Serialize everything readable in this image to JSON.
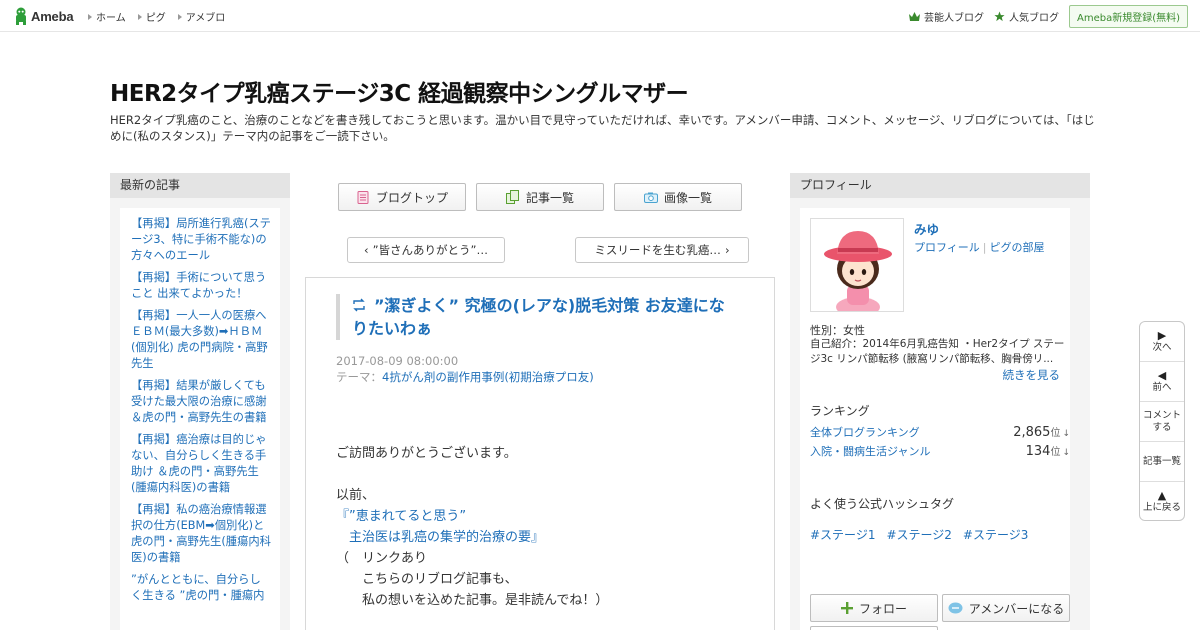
{
  "header": {
    "logo_text": "Ameba",
    "nav": [
      "ホーム",
      "ピグ",
      "アメブロ"
    ],
    "right_links": [
      {
        "label": "芸能人ブログ",
        "icon": "crown-icon"
      },
      {
        "label": "人気ブログ",
        "icon": "star-icon"
      }
    ],
    "register_label": "Ameba新規登録(無料)"
  },
  "blog": {
    "title": "HER2タイプ乳癌ステージ3C 経過観察中シングルマザー",
    "description": "HER2タイプ乳癌のこと、治療のことなどを書き残しておこうと思います。温かい目で見守っていただければ、幸いです。アメンバー申請、コメント、メッセージ、リブログについては、「はじめに(私のスタンス)」テーマ内の記事をご一読下さい。"
  },
  "left_sidebar": {
    "heading": "最新の記事",
    "recent": [
      "【再掲】局所進行乳癌(ステージ3、特に手術不能な)の方々へのエール",
      "【再掲】手術について思うこと 出来てよかった！",
      "【再掲】一人一人の医療へ ＥＢＭ(最大多数)➡ＨＢＭ(個別化) 虎の門病院・高野先生",
      "【再掲】結果が厳しくても受けた最大限の治療に感謝 ＆虎の門・高野先生の書籍",
      "【再掲】癌治療は目的じゃない、自分らしく生きる手助け ＆虎の門・高野先生(腫瘍内科医)の書籍",
      "【再掲】私の癌治療情報選択の仕方(EBM➡個別化)と虎の門・高野先生(腫瘍内科医)の書籍",
      "”がんとともに、自分らしく生きる ”虎の門・腫瘍内"
    ]
  },
  "center": {
    "buttons": [
      {
        "label": "ブログトップ",
        "icon": "document-icon"
      },
      {
        "label": "記事一覧",
        "icon": "copy-icon"
      },
      {
        "label": "画像一覧",
        "icon": "camera-icon"
      }
    ],
    "prev_label": "”皆さんありがとう”…",
    "next_label": "ミスリードを生む乳癌…",
    "article": {
      "title": "”潔ぎよく” 究極の(レアな)脱毛対策 お友達になりたいわぁ",
      "date": "2017-08-09 08:00:00",
      "theme_prefix": "テーマ：",
      "theme": "4抗がん剤の副作用事例(初期治療プロ友)",
      "body": {
        "line1": "ご訪問ありがとうございます。",
        "line2": "以前、",
        "line3": "『”恵まれてると思う”",
        "line4": "　主治医は乳癌の集学的治療の要』",
        "line5": "（　リンクあり",
        "line6": "　　こちらのリブログ記事も、",
        "line7": "　　私の想いを込めた記事。是非読んでね！）"
      }
    }
  },
  "right_sidebar": {
    "heading": "プロフィール",
    "name": "みゆ",
    "profile_link": "プロフィール",
    "pig_link": "ピグの部屋",
    "sex": "性別：女性",
    "intro": "自己紹介：2014年6月乳癌告知 ・Her2タイプ ステージ3c リンパ節転移 (腋窩リンパ節転移、胸骨傍リ...",
    "more": "続きを見る",
    "ranking_heading": "ランキング",
    "rankings": [
      {
        "label": "全体ブログランキング",
        "value": "2,865",
        "unit": "位",
        "arrow": "↓"
      },
      {
        "label": "入院・闘病生活ジャンル",
        "value": "134",
        "unit": "位",
        "arrow": "↓"
      }
    ],
    "hashtag_heading": "よく使う公式ハッシュタグ",
    "hashtags": [
      "#ステージ1",
      "#ステージ2",
      "#ステージ3"
    ],
    "follow_label": "フォロー",
    "amember_label": "アメンバーになる"
  },
  "float_nav": {
    "next": "次へ",
    "prev": "前へ",
    "comment_1": "コメント",
    "comment_2": "する",
    "list": "記事一覧",
    "top": "上に戻る"
  },
  "colors": {
    "link": "#1f6fb8",
    "sidebar_bg": "#f4f4f4",
    "sidebar_head": "#e4e4e4",
    "ameba_green": "#3a8a2e"
  }
}
